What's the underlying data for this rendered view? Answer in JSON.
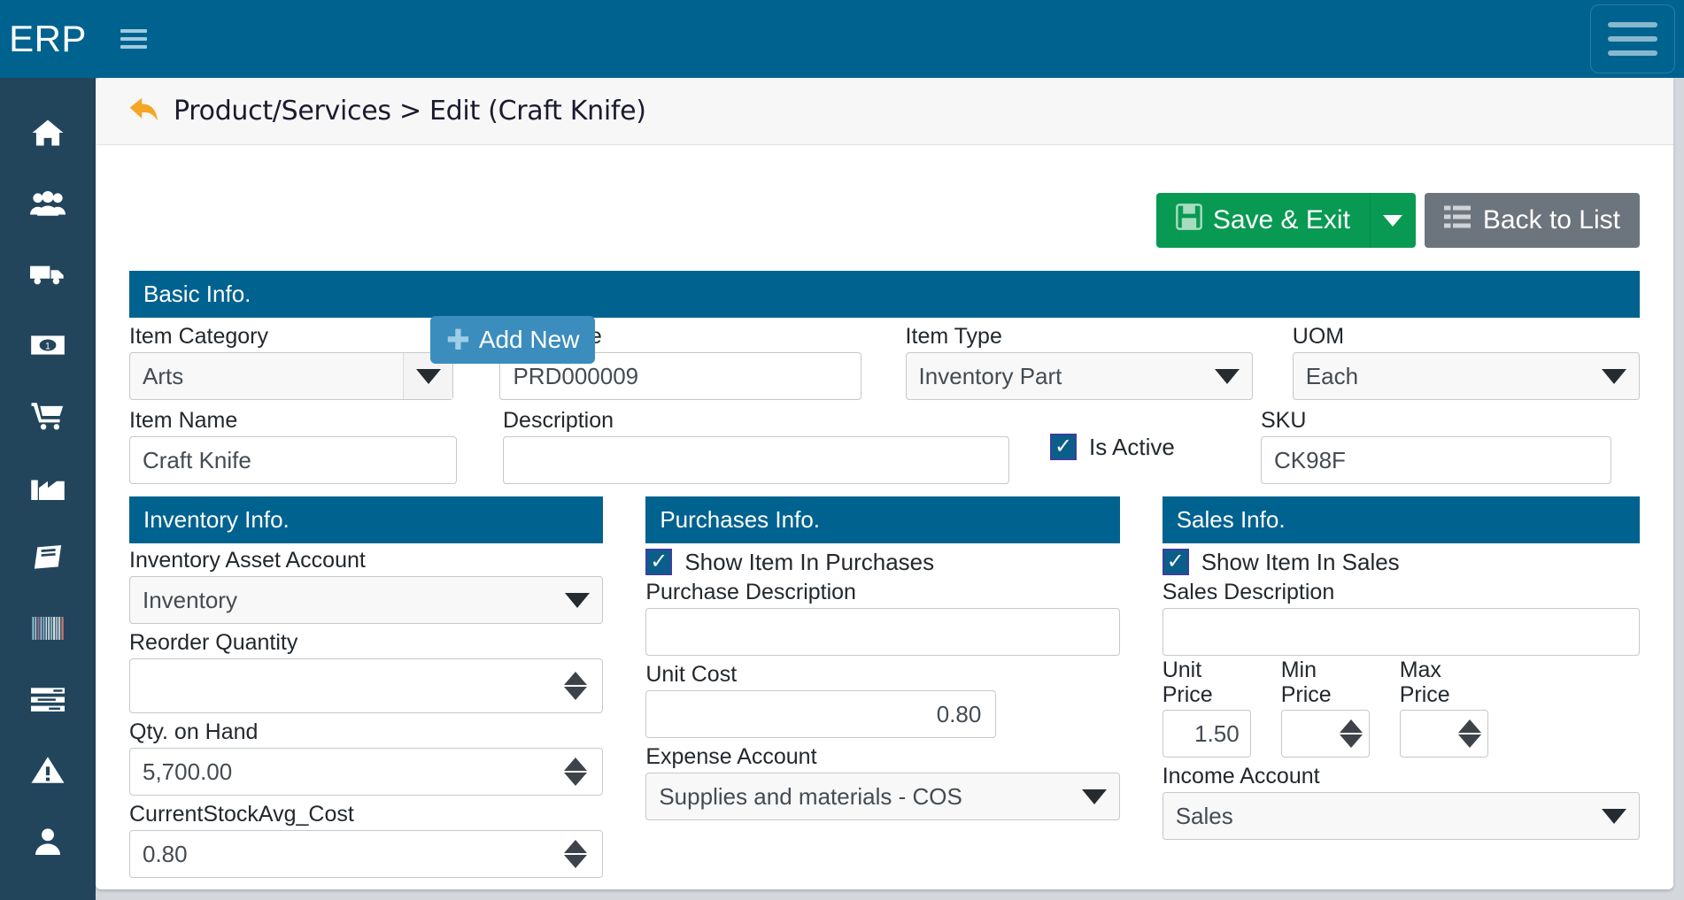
{
  "topbar": {
    "brand": "ERP",
    "menu_toggle_icon": "hamburger-icon",
    "right_toggle_icon": "hamburger-icon"
  },
  "sidebar": {
    "items": [
      {
        "icon": "home-icon",
        "name": "sidebar-item-home"
      },
      {
        "icon": "users-icon",
        "name": "sidebar-item-contacts"
      },
      {
        "icon": "truck-icon",
        "name": "sidebar-item-shipping"
      },
      {
        "icon": "money-bill-icon",
        "name": "sidebar-item-banking"
      },
      {
        "icon": "shopping-cart-icon",
        "name": "sidebar-item-sales"
      },
      {
        "icon": "factory-icon",
        "name": "sidebar-item-manufacturing"
      },
      {
        "icon": "book-icon",
        "name": "sidebar-item-accounting"
      },
      {
        "icon": "barcode-icon",
        "name": "sidebar-item-inventory"
      },
      {
        "icon": "list-icon",
        "name": "sidebar-item-reports"
      },
      {
        "icon": "warning-icon",
        "name": "sidebar-item-alerts"
      },
      {
        "icon": "user-icon",
        "name": "sidebar-item-account"
      }
    ]
  },
  "breadcrumb": {
    "back_icon": "back-arrow-icon",
    "text": "Product/Services > Edit (Craft Knife)"
  },
  "toolbar": {
    "save_label": "Save & Exit",
    "save_icon": "floppy-disk-icon",
    "save_caret_icon": "chevron-down-icon",
    "back_label": "Back to List",
    "back_icon": "list-icon"
  },
  "basic": {
    "title": "Basic Info.",
    "add_new_label": "Add New",
    "add_new_icon": "plus-icon",
    "item_category_label": "Item Category",
    "item_category_value": "Arts",
    "item_code_label": "Item Code",
    "item_code_value": "PRD000009",
    "item_type_label": "Item Type",
    "item_type_value": "Inventory Part",
    "uom_label": "UOM",
    "uom_value": "Each",
    "item_name_label": "Item Name",
    "item_name_value": "Craft Knife",
    "description_label": "Description",
    "description_value": "",
    "is_active_label": "Is Active",
    "is_active_checked": "✓",
    "sku_label": "SKU",
    "sku_value": "CK98F"
  },
  "inventory": {
    "title": "Inventory Info.",
    "asset_account_label": "Inventory Asset Account",
    "asset_account_value": "Inventory",
    "reorder_qty_label": "Reorder Quantity",
    "reorder_qty_value": "",
    "qty_on_hand_label": "Qty. on Hand",
    "qty_on_hand_value": "5,700.00",
    "avg_cost_label": "CurrentStockAvg_Cost",
    "avg_cost_value": "0.80"
  },
  "purchases": {
    "title": "Purchases Info.",
    "show_item_label": "Show Item In Purchases",
    "show_item_checked": "✓",
    "purchase_desc_label": "Purchase Description",
    "purchase_desc_value": "",
    "unit_cost_label": "Unit Cost",
    "unit_cost_value": "0.80",
    "expense_account_label": "Expense Account",
    "expense_account_value": "Supplies and materials - COS"
  },
  "sales": {
    "title": "Sales Info.",
    "show_item_label": "Show Item In Sales",
    "show_item_checked": "✓",
    "sales_desc_label": "Sales Description",
    "sales_desc_value": "",
    "unit_price_label_1": "Unit",
    "unit_price_label_2": "Price",
    "unit_price_value": "1.50",
    "min_price_label_1": "Min",
    "min_price_label_2": "Price",
    "min_price_value": "",
    "max_price_label_1": "Max",
    "max_price_label_2": "Price",
    "max_price_value": "",
    "income_account_label": "Income Account",
    "income_account_value": "Sales"
  },
  "colors": {
    "header_blue": "#00628f",
    "sidebar_navy": "#22455c",
    "save_green": "#089a52",
    "back_gray": "#6c757d",
    "add_new_blue": "#3b8dbd",
    "arrow_orange": "#f5a623"
  }
}
